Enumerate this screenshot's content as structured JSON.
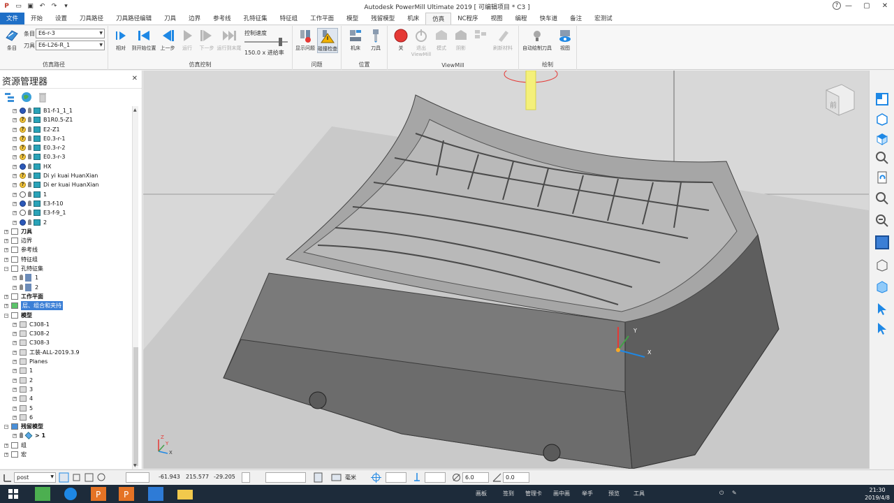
{
  "window": {
    "title": "Autodesk PowerMill Ultimate 2019   [ 可编辑项目 * C3 ]",
    "controls": [
      "—",
      "▢",
      "✕"
    ]
  },
  "menu": {
    "tabs": [
      "文件",
      "开始",
      "设置",
      "刀具路径",
      "刀具路径编辑",
      "刀具",
      "边界",
      "参考线",
      "孔特征集",
      "特征组",
      "工作平面",
      "模型",
      "残留模型",
      "机床",
      "仿真",
      "NC程序",
      "视图",
      "编程",
      "快车道",
      "备注",
      "宏测试"
    ],
    "active": "仿真"
  },
  "ribbon": {
    "sim_path": {
      "group_label": "仿真路径",
      "entity_btn": "条目",
      "entity_label": "条目",
      "entity_value": "E6-r-3",
      "tool_label": "刀具",
      "tool_value": "E6-L26-R_1"
    },
    "sim_control": {
      "group_label": "仿真控制",
      "buttons": [
        "相对",
        "到开始位置",
        "上一步",
        "运行",
        "下一步",
        "运行到末尾"
      ],
      "speed_label": "控制速度",
      "speed_value": "150.0 x 进给率"
    },
    "issues": {
      "group_label": "问题",
      "buttons": [
        "显示问题",
        "碰撞检查"
      ]
    },
    "position": {
      "group_label": "位置",
      "buttons": [
        "机床",
        "刀具"
      ]
    },
    "viewmill": {
      "group_label": "ViewMill",
      "buttons": [
        "关",
        "退出ViewMill",
        "模式",
        "阴影",
        "",
        "刷新材料"
      ]
    },
    "draw": {
      "group_label": "绘制",
      "buttons": [
        "自动绘制刀具",
        "视图"
      ]
    }
  },
  "explorer": {
    "title": "资源管理器",
    "tree": [
      {
        "label": "B1-f-1_1_1",
        "status": "ok",
        "kind": "toolpath",
        "indent": 1
      },
      {
        "label": "B1R0.5-Z1",
        "status": "q",
        "kind": "toolpath",
        "indent": 1
      },
      {
        "label": "E2-Z1",
        "status": "q",
        "kind": "toolpath",
        "indent": 1
      },
      {
        "label": "E0.3-r-1",
        "status": "q",
        "kind": "toolpath",
        "indent": 1
      },
      {
        "label": "E0.3-r-2",
        "status": "q",
        "kind": "toolpath",
        "indent": 1
      },
      {
        "label": "E0.3-r-3",
        "status": "q",
        "kind": "toolpath",
        "indent": 1
      },
      {
        "label": "HX",
        "status": "ok",
        "kind": "toolpath",
        "indent": 1
      },
      {
        "label": "Di yi kuai HuanXian",
        "status": "q",
        "kind": "toolpath",
        "indent": 1
      },
      {
        "label": "Di er kuai HuanXian",
        "status": "q",
        "kind": "toolpath",
        "indent": 1
      },
      {
        "label": "1",
        "status": "chk",
        "kind": "toolpath",
        "indent": 1
      },
      {
        "label": "E3-f-10",
        "status": "ok",
        "kind": "toolpath",
        "indent": 1
      },
      {
        "label": "E3-f-9_1",
        "status": "chk",
        "kind": "toolpath",
        "indent": 1
      },
      {
        "label": "2",
        "status": "ok",
        "kind": "toolpath",
        "indent": 1
      },
      {
        "label": "刀具",
        "status": "",
        "kind": "folder-tool",
        "indent": 0,
        "bold": true
      },
      {
        "label": "边界",
        "status": "",
        "kind": "folder-boundary",
        "indent": 0
      },
      {
        "label": "参考线",
        "status": "",
        "kind": "folder-pattern",
        "indent": 0
      },
      {
        "label": "特征组",
        "status": "",
        "kind": "folder-feature",
        "indent": 0
      },
      {
        "label": "孔特征集",
        "status": "",
        "kind": "folder-hole",
        "indent": 0,
        "open": true
      },
      {
        "label": "1",
        "status": "",
        "kind": "hole",
        "indent": 1
      },
      {
        "label": "2",
        "status": "",
        "kind": "hole",
        "indent": 1
      },
      {
        "label": "工作平面",
        "status": "",
        "kind": "folder-wp",
        "indent": 0,
        "bold": true
      },
      {
        "label": "层、组合和夹持",
        "status": "",
        "kind": "folder-layer",
        "indent": 0,
        "selected": true
      },
      {
        "label": "模型",
        "status": "",
        "kind": "folder-model",
        "indent": 0,
        "bold": true,
        "open": true
      },
      {
        "label": "C308-1",
        "status": "",
        "kind": "model",
        "indent": 1
      },
      {
        "label": "C308-2",
        "status": "",
        "kind": "model",
        "indent": 1
      },
      {
        "label": "C308-3",
        "status": "",
        "kind": "model",
        "indent": 1
      },
      {
        "label": "工装-ALL-2019.3.9",
        "status": "",
        "kind": "model",
        "indent": 1
      },
      {
        "label": "Planes",
        "status": "",
        "kind": "model",
        "indent": 1
      },
      {
        "label": "1",
        "status": "",
        "kind": "model",
        "indent": 1
      },
      {
        "label": "2",
        "status": "",
        "kind": "model",
        "indent": 1
      },
      {
        "label": "3",
        "status": "",
        "kind": "model",
        "indent": 1
      },
      {
        "label": "4",
        "status": "",
        "kind": "model",
        "indent": 1
      },
      {
        "label": "5",
        "status": "",
        "kind": "model",
        "indent": 1
      },
      {
        "label": "6",
        "status": "",
        "kind": "model",
        "indent": 1
      },
      {
        "label": "残留模型",
        "status": "",
        "kind": "folder-stock",
        "indent": 0,
        "bold": true,
        "open": true
      },
      {
        "label": "> 1",
        "status": "",
        "kind": "stock",
        "indent": 1,
        "bold": true
      },
      {
        "label": "组",
        "status": "",
        "kind": "folder-group",
        "indent": 0
      },
      {
        "label": "宏",
        "status": "",
        "kind": "folder-macro",
        "indent": 0
      }
    ]
  },
  "viewport": {
    "viewcube_face": "前",
    "axis_labels": {
      "x": "X",
      "y": "Y",
      "z": "Z"
    }
  },
  "status": {
    "workplane": "post",
    "coords": [
      "-61.943",
      "215.577",
      "-29.205"
    ],
    "units": "毫米",
    "diameter": "6.0",
    "angle": "0.0"
  },
  "taskbar": {
    "tray_items": [
      "画板",
      "签到",
      "管理卡",
      "画中画",
      "举手",
      "预览",
      "工具"
    ],
    "time": "21:30",
    "date": "2019/4/8"
  },
  "colors": {
    "accent": "#1e6fc7",
    "model_grey": "#8a8a8a",
    "background": "#d8d8d8"
  }
}
